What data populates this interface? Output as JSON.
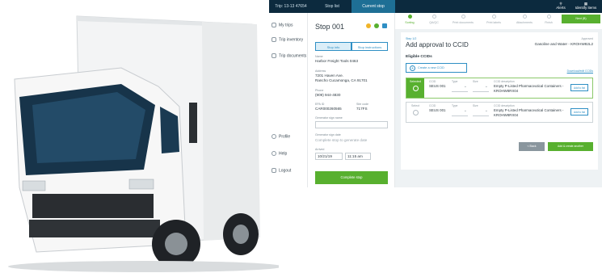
{
  "header": {
    "trip_label": "Trip: 13-13 47654",
    "tabs": [
      {
        "label": "Stop list"
      },
      {
        "label": "Current stop"
      }
    ],
    "alerts_label": "Alerts",
    "identify_label": "Identify items"
  },
  "sidebar": {
    "items": [
      {
        "label": "My trips"
      },
      {
        "label": "Trip inventory"
      },
      {
        "label": "Trip documents"
      },
      {
        "label": "Profile"
      },
      {
        "label": "Help"
      },
      {
        "label": "Logout"
      }
    ]
  },
  "stop": {
    "title": "Stop 001",
    "segments": [
      "Stop info",
      "Stop instructions"
    ],
    "fields": [
      {
        "label": "Name",
        "value": "Harbor Freight Tools 0463"
      },
      {
        "label": "Address",
        "value": "7201 Haven Ave.\nRancho Cucamonga, CA 91701"
      },
      {
        "label": "Phone",
        "value": "(909) 944-4830"
      },
      {
        "label": "EPA ID",
        "value": "CAR000260565"
      },
      {
        "label": "Site code",
        "value": "717FS"
      }
    ],
    "signer_label": "Generator sign name",
    "sign_date_label": "Generator sign date",
    "sign_date_note": "Complete stop to generate date",
    "arrival_label": "Arrived",
    "arrival_date": "10/21/19",
    "arrival_time": "11:15 am",
    "complete_label": "Complete stop"
  },
  "stepper": {
    "steps": [
      "Sorting",
      "QA/QC",
      "Print documents",
      "Print labels",
      "Attachments",
      "Finish"
    ],
    "next_label": "Next (B)"
  },
  "approval": {
    "step_label": "Step 1/2",
    "heading": "Add approval to CCID",
    "approved_label": "Approved",
    "approved_value": "Gasoline and Water - KROHW82L2",
    "eligible_label": "Eligible CCIDs",
    "create_label": "Create a new CCID",
    "download_label": "Download/edit CCIDs",
    "rows": [
      {
        "pick": "Selected",
        "ccid": "SEUS 001",
        "desc": "Empty P-Listed Pharmaceutical Containers - KROHW8RX04",
        "action": "Add to list"
      },
      {
        "pick": "Select",
        "ccid": "SEUS 001",
        "desc": "Empty P-Listed Pharmaceutical Containers - KROHW8RX04",
        "action": "Add to list"
      }
    ],
    "col_ccid": "CCID",
    "col_type": "Type",
    "col_size": "Size",
    "col_desc": "CCID description",
    "back_label": "< Back",
    "add_more_label": "Add & create another"
  }
}
